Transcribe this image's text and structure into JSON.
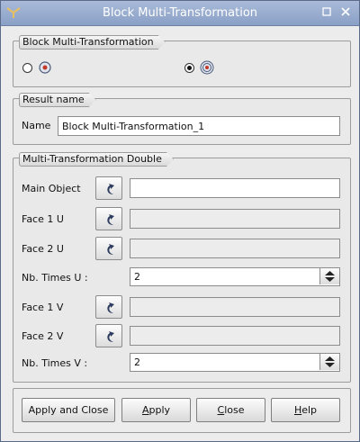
{
  "window": {
    "title": "Block Multi-Transformation"
  },
  "groups": {
    "type": {
      "title": "Block Multi-Transformation",
      "options": [
        "simple",
        "double"
      ],
      "selected": 1
    },
    "result": {
      "title": "Result name",
      "name_label": "Name",
      "name_value": "Block Multi-Transformation_1"
    },
    "double": {
      "title": "Multi-Transformation Double",
      "main_object_label": "Main Object",
      "face1u_label": "Face 1 U",
      "face2u_label": "Face 2 U",
      "nbu_label": "Nb. Times U :",
      "nbu_value": "2",
      "face1v_label": "Face 1 V",
      "face2v_label": "Face 2 V",
      "nbv_label": "Nb. Times V :",
      "nbv_value": "2"
    }
  },
  "buttons": {
    "apply_close": "Apply and Close",
    "apply_first": "A",
    "apply_rest": "pply",
    "close_first": "C",
    "close_rest": "lose",
    "help_first": "H",
    "help_rest": "elp"
  },
  "icons": {
    "app": "app-icon",
    "minimize": "minimize-icon",
    "close": "close-icon",
    "select": "selection-arrow-icon",
    "spin": "spin-updown-icon"
  },
  "colors": {
    "titlebar": "#98abcf",
    "selected_field": "#ffffff",
    "disabled_field": "#ececec"
  }
}
